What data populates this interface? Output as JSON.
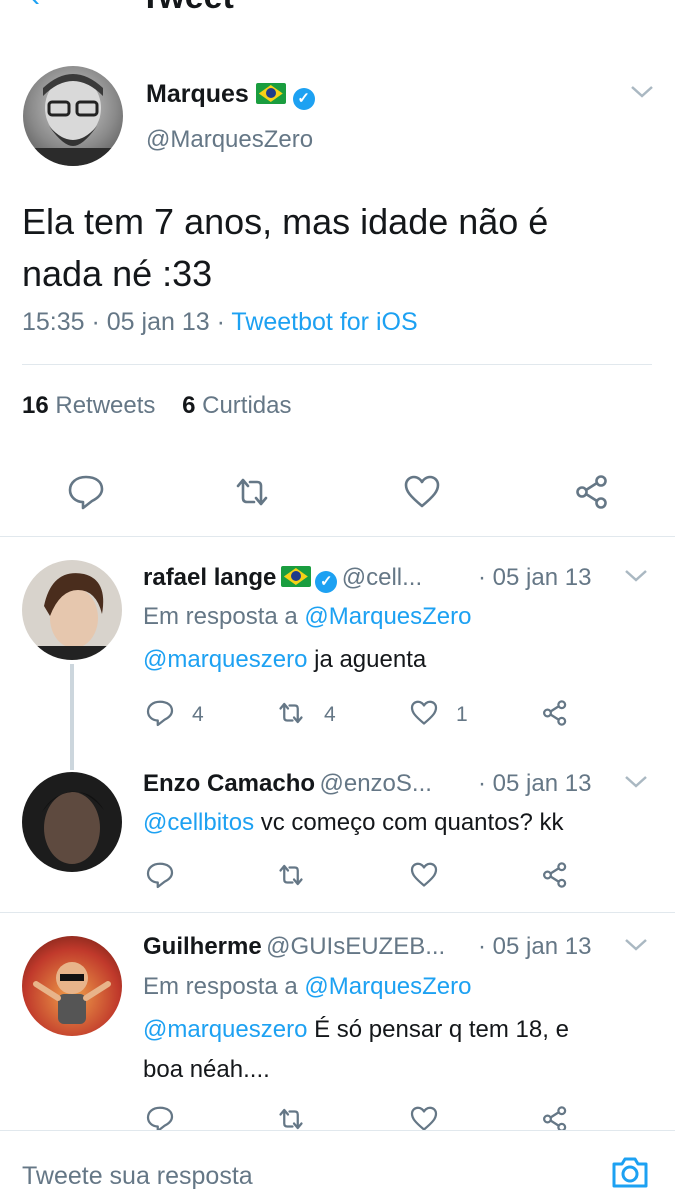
{
  "header": {
    "title": "Tweet"
  },
  "main_tweet": {
    "name": "Marques",
    "handle": "@MarquesZero",
    "text_line1": "Ela tem 7 anos, mas idade não é",
    "text_line2": "nada né :33",
    "time": "15:35",
    "date": "05 jan 13",
    "client": "Tweetbot for iOS",
    "retweets_count": "16",
    "retweets_label": "Retweets",
    "likes_count": "6",
    "likes_label": "Curtidas"
  },
  "replies": [
    {
      "name": "rafael lange",
      "handle": "@cell...",
      "date": "· 05 jan 13",
      "reply_prefix": "Em resposta a",
      "reply_to": "@MarquesZero",
      "mention": "@marqueszero",
      "text": "ja aguenta",
      "reply_count": "4",
      "retweet_count": "4",
      "like_count": "1"
    },
    {
      "name": "Enzo Camacho",
      "handle": "@enzoS...",
      "date": "· 05 jan 13",
      "mention": "@cellbitos",
      "text": "vc começo com quantos? kk"
    },
    {
      "name": "Guilherme",
      "handle": "@GUIsEUZEB...",
      "date": "· 05 jan 13",
      "reply_prefix": "Em resposta a",
      "reply_to": "@MarquesZero",
      "mention": "@marqueszero",
      "text_line1": "É só pensar q tem 18, e",
      "text_line2": "boa néah...."
    }
  ],
  "footer": {
    "placeholder": "Tweete sua resposta"
  },
  "colors": {
    "accent": "#1da1f2",
    "muted": "#657786",
    "divider": "#e1e8ed"
  }
}
